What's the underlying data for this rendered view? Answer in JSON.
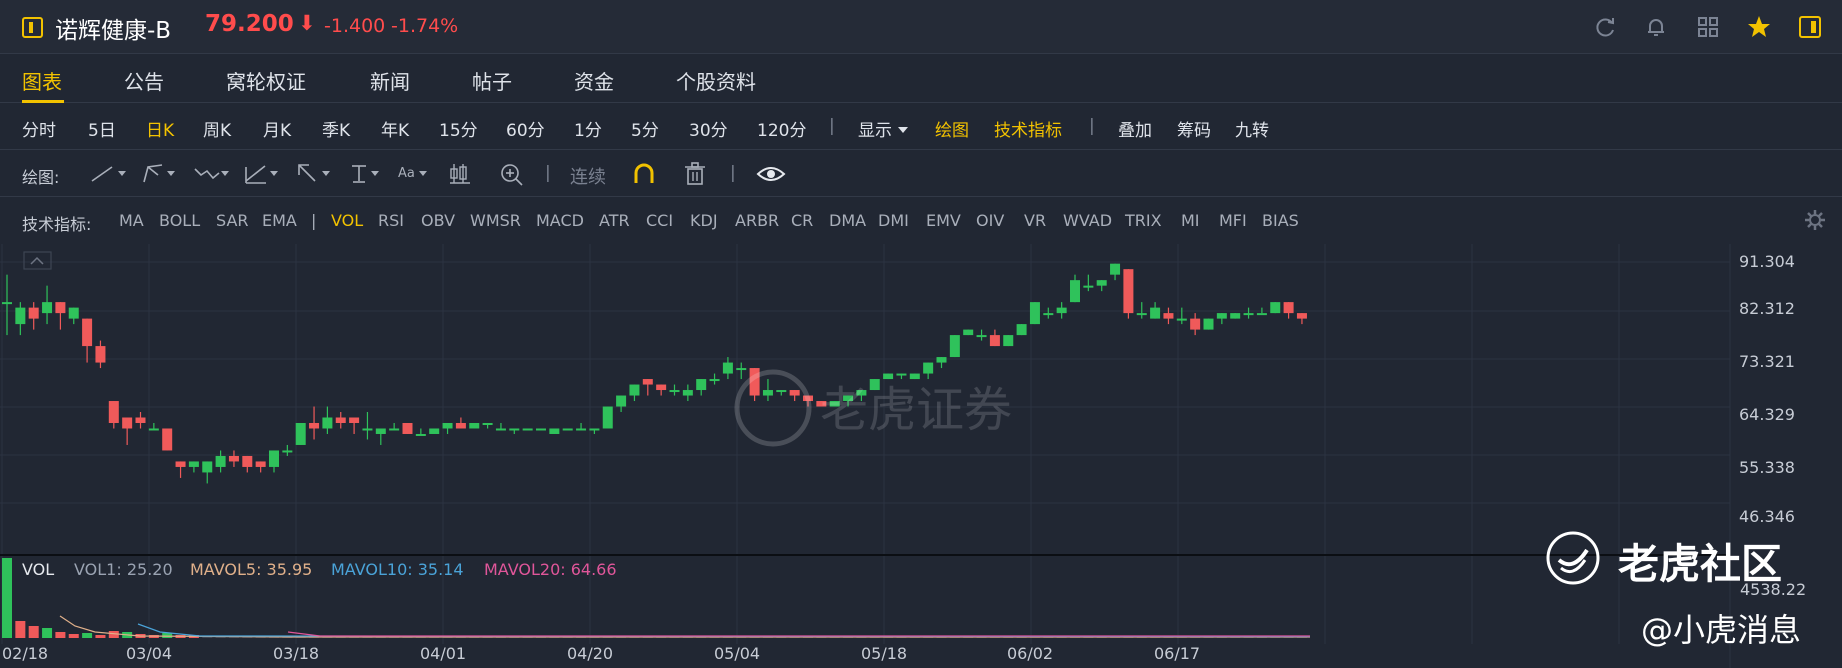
{
  "header": {
    "name": "诺辉健康-B",
    "price": "79.200",
    "arrow": "⬇",
    "change": "-1.400",
    "change_pct": "-1.74%",
    "icons": [
      "refresh-icon",
      "bell-icon",
      "grid-icon",
      "star-icon",
      "panel-icon"
    ]
  },
  "tabs": [
    "图表",
    "公告",
    "窝轮权证",
    "新闻",
    "帖子",
    "资金",
    "个股资料"
  ],
  "periods": {
    "items": [
      "分时",
      "5日",
      "日K",
      "周K",
      "月K",
      "季K",
      "年K",
      "15分",
      "60分",
      "1分",
      "5分",
      "30分",
      "120分"
    ],
    "active": "日K",
    "display": "显示",
    "draw": "绘图",
    "tech": "技术指标",
    "extra": [
      "叠加",
      "筹码",
      "九转"
    ]
  },
  "drawing": {
    "label": "绘图:",
    "continuous": "连续",
    "font_tool": "Aa"
  },
  "indicators": {
    "label": "技术指标:",
    "main": [
      "MA",
      "BOLL",
      "SAR",
      "EMA"
    ],
    "sub": [
      "VOL",
      "RSI",
      "OBV",
      "WMSR",
      "MACD",
      "ATR",
      "CCI",
      "KDJ",
      "ARBR",
      "CR",
      "DMA",
      "DMI",
      "EMV",
      "OIV",
      "VR",
      "WVAD",
      "TRIX",
      "MI",
      "MFI",
      "BIAS"
    ],
    "active": "VOL"
  },
  "chart_data": {
    "type": "candlestick",
    "y_ticks": [
      "91.304",
      "82.312",
      "73.321",
      "64.329",
      "55.338",
      "46.346"
    ],
    "ylim": [
      46.346,
      91.304
    ],
    "x_ticks": [
      "02/18",
      "03/04",
      "03/18",
      "04/01",
      "04/20",
      "05/04",
      "05/18",
      "06/02",
      "06/17"
    ],
    "candles": [
      [
        84,
        84,
        78,
        89
      ],
      [
        80,
        83,
        78,
        84
      ],
      [
        83,
        81,
        79,
        84
      ],
      [
        82,
        84,
        80,
        87
      ],
      [
        84,
        82,
        79,
        84
      ],
      [
        81,
        83,
        80,
        83
      ],
      [
        81,
        76,
        73,
        81
      ],
      [
        76,
        73,
        72,
        77
      ],
      [
        66,
        62,
        61,
        66
      ],
      [
        63,
        61,
        58,
        63
      ],
      [
        63,
        62,
        61,
        64
      ],
      [
        61,
        61,
        61,
        62
      ],
      [
        61,
        57,
        57,
        61
      ],
      [
        55,
        54,
        52,
        55
      ],
      [
        54,
        55,
        53,
        55
      ],
      [
        53,
        55,
        51,
        55
      ],
      [
        54,
        56,
        53,
        57
      ],
      [
        56,
        55,
        54,
        57
      ],
      [
        56,
        54,
        53,
        56
      ],
      [
        55,
        54,
        53,
        55
      ],
      [
        54,
        57,
        53,
        57
      ],
      [
        57,
        57,
        56,
        58
      ],
      [
        58,
        62,
        58,
        62
      ],
      [
        62,
        61,
        59,
        65
      ],
      [
        61,
        63,
        60,
        65
      ],
      [
        63,
        62,
        61,
        64
      ],
      [
        63,
        62,
        60,
        63
      ],
      [
        61,
        61,
        59,
        64
      ],
      [
        60,
        61,
        58,
        61
      ],
      [
        61,
        61,
        61,
        62
      ],
      [
        62,
        60,
        60,
        62
      ],
      [
        60,
        60,
        60,
        61
      ],
      [
        60,
        61,
        60,
        61
      ],
      [
        61,
        62,
        60,
        62
      ],
      [
        62,
        61,
        61,
        63
      ],
      [
        61,
        62,
        61,
        62
      ],
      [
        62,
        62,
        61,
        62
      ],
      [
        61,
        61,
        61,
        62
      ],
      [
        61,
        61,
        60,
        61
      ],
      [
        61,
        61,
        61,
        61
      ],
      [
        61,
        61,
        61,
        61
      ],
      [
        60,
        61,
        60,
        61
      ],
      [
        61,
        61,
        61,
        61
      ],
      [
        61,
        61,
        61,
        62
      ],
      [
        61,
        61,
        60,
        61
      ],
      [
        61,
        65,
        61,
        65
      ],
      [
        65,
        67,
        64,
        67
      ],
      [
        67,
        69,
        66,
        69
      ],
      [
        70,
        69,
        67,
        70
      ],
      [
        69,
        68,
        67,
        69
      ],
      [
        68,
        68,
        67,
        69
      ],
      [
        67,
        68,
        66,
        69
      ],
      [
        68,
        70,
        67,
        70
      ],
      [
        70,
        70,
        69,
        71
      ],
      [
        71,
        73,
        70,
        74
      ],
      [
        72,
        72,
        70,
        73
      ],
      [
        72,
        67,
        66,
        72
      ],
      [
        67,
        68,
        66,
        70
      ],
      [
        68,
        68,
        67,
        68
      ],
      [
        68,
        67,
        66,
        68
      ],
      [
        67,
        66,
        65,
        67
      ],
      [
        66,
        65,
        65,
        66
      ],
      [
        65,
        66,
        65,
        66
      ],
      [
        66,
        67,
        65,
        67
      ],
      [
        67,
        68,
        66,
        68
      ],
      [
        68,
        70,
        68,
        70
      ],
      [
        70,
        71,
        70,
        71
      ],
      [
        71,
        71,
        70,
        71
      ],
      [
        70,
        71,
        70,
        71
      ],
      [
        71,
        73,
        70,
        73
      ],
      [
        73,
        74,
        72,
        74
      ],
      [
        74,
        78,
        74,
        78
      ],
      [
        78,
        79,
        78,
        79
      ],
      [
        78,
        78,
        77,
        79
      ],
      [
        78,
        76,
        76,
        79
      ],
      [
        76,
        78,
        76,
        78
      ],
      [
        78,
        80,
        78,
        80
      ],
      [
        80,
        84,
        80,
        84
      ],
      [
        82,
        82,
        81,
        83
      ],
      [
        82,
        83,
        81,
        84
      ],
      [
        84,
        88,
        84,
        89
      ],
      [
        87,
        87,
        86,
        89
      ],
      [
        87,
        88,
        86,
        88
      ],
      [
        89,
        91,
        88,
        91
      ],
      [
        90,
        82,
        81,
        90
      ],
      [
        82,
        82,
        81,
        84
      ],
      [
        81,
        83,
        81,
        84
      ],
      [
        82,
        81,
        80,
        83
      ],
      [
        81,
        81,
        80,
        83
      ],
      [
        81,
        79,
        78,
        82
      ],
      [
        79,
        81,
        79,
        81
      ],
      [
        81,
        82,
        80,
        82
      ],
      [
        81,
        82,
        81,
        82
      ],
      [
        82,
        82,
        81,
        83
      ],
      [
        82,
        82,
        82,
        83
      ],
      [
        82,
        84,
        82,
        84
      ],
      [
        84,
        82,
        81,
        84
      ],
      [
        82,
        81,
        80,
        82
      ]
    ],
    "volume": {
      "label": "VOL",
      "items": [
        {
          "name": "VOL1",
          "value": "25.20",
          "color": "#9aa3b2"
        },
        {
          "name": "MAVOL5",
          "value": "35.95",
          "color": "#e0b08a"
        },
        {
          "name": "MAVOL10",
          "value": "35.14",
          "color": "#4aa3d8"
        },
        {
          "name": "MAVOL20",
          "value": "64.66",
          "color": "#e0569a"
        }
      ],
      "max_label": "4538.22"
    }
  },
  "watermarks": {
    "center": "老虎证券",
    "community": "老虎社区",
    "user": "@小虎消息"
  },
  "colors": {
    "up": "#2fc25b",
    "down": "#f05a5a",
    "accent": "#f2c200",
    "background": "#212733"
  }
}
